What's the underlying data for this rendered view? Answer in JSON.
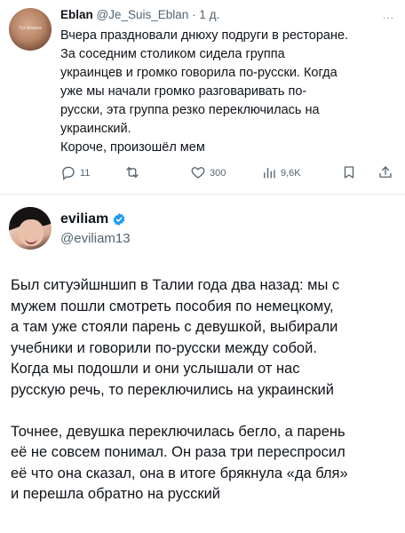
{
  "tweet1": {
    "author_name": "Eblan",
    "author_handle": "@Je_Suis_Eblan",
    "separator": "·",
    "time": "1 д.",
    "avatar_text": "Тут вітерок",
    "more": "...",
    "text_lines": [
      "Вчера праздновали днюху подруги в ресторане.",
      "За соседним столиком сидела группа",
      "украинцев и громко говорила по-русски. Когда",
      "уже мы начали громко разговаривать по-",
      "русски, эта группа резко переключилась на",
      "украинский.",
      "Короче, произошёл мем"
    ],
    "actions": {
      "replies": "11",
      "retweets": "",
      "likes": "300",
      "views": "9,6K"
    }
  },
  "tweet2": {
    "author_name": "eviliam",
    "author_handle": "@eviliam13",
    "paragraph1_lines": [
      "Был ситуэйшншип в Талии года два назад: мы с",
      "мужем пошли смотреть пособия по немецкому,",
      "а там уже стояли парень с девушкой, выбирали",
      "учебники и говорили по-русски между собой.",
      "Когда мы подошли и они услышали от нас",
      "русскую речь, то переключились на украинский"
    ],
    "paragraph2_lines": [
      "Точнее, девушка переключилась бегло, а парень",
      "её не совсем понимал. Он раза три переспросил",
      "её что она сказал, она в итоге брякнула «да бля»",
      "и перешла обратно на русский"
    ]
  },
  "colors": {
    "text": "#0f1419",
    "secondary": "#536471",
    "verified": "#1d9bf0",
    "separator": "#e6e9eb"
  },
  "icons": {
    "reply": "reply-icon",
    "retweet": "retweet-icon",
    "like": "heart-icon",
    "views": "views-icon",
    "bookmark": "bookmark-icon",
    "share": "share-icon",
    "verified": "verified-badge-icon"
  }
}
